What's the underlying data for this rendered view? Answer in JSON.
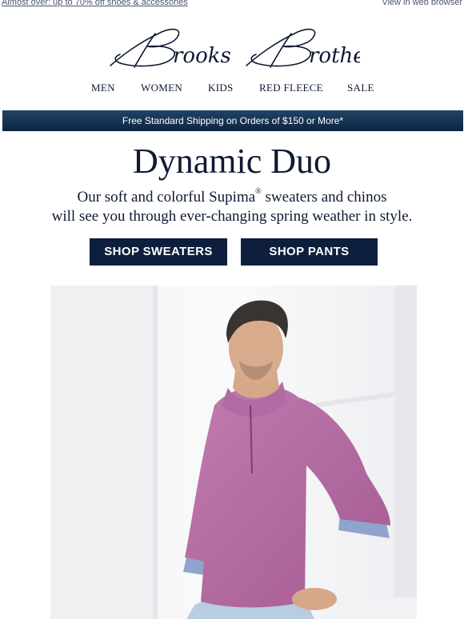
{
  "preheader": {
    "promo_link": "Almost over: up to 70% off shoes & accessories",
    "view_browser": "View in web browser"
  },
  "brand": {
    "logo_text": "Brooks Brothers",
    "color": "#0e1a33"
  },
  "nav": {
    "items": [
      "MEN",
      "WOMEN",
      "KIDS",
      "RED FLEECE",
      "SALE"
    ]
  },
  "shipping_banner": {
    "text": "Free Standard Shipping on Orders of $150 or More*"
  },
  "hero_copy": {
    "headline": "Dynamic Duo",
    "line1_a": "Our soft and colorful Supima",
    "line1_reg": "®",
    "line1_b": " sweaters and chinos",
    "line2": "will see you through ever-changing spring weather in style."
  },
  "cta": {
    "sweaters": "SHOP SWEATERS",
    "pants": "SHOP PANTS",
    "color": "#0d1f3c"
  },
  "hero_image": {
    "alt": "Man in a pink quarter-zip sweater seated by a window"
  },
  "colors": {
    "sweater": "#b86fa6",
    "banner": "#12294a"
  }
}
